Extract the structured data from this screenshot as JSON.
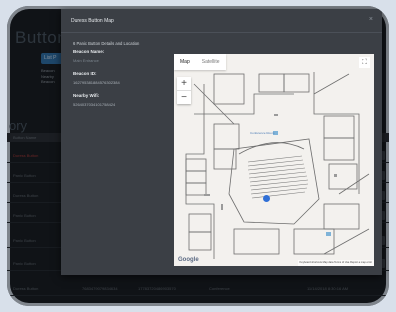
{
  "background": {
    "title": "Button D",
    "button_label": "List P",
    "info_lines": [
      "Beacon",
      "Nearby",
      "Beacon"
    ],
    "section_title": "ory",
    "table_header": "Button Name",
    "rows": [
      {
        "name": "Duress Button",
        "status": "red"
      },
      {
        "name": "Panic Button",
        "status": "normal"
      },
      {
        "name": "Duress Button",
        "status": "normal"
      },
      {
        "name": "Panic Button",
        "status": "normal"
      },
      {
        "name": "Panic Button",
        "status": "normal"
      },
      {
        "name": "Panic Button",
        "status": "normal"
      }
    ],
    "last_row": {
      "name": "Duress Button",
      "beacon": "7683479079834634",
      "mac": "17783720486903570",
      "location": "Conference",
      "date": "11/14/2018 8:30:16 AM"
    }
  },
  "modal": {
    "title": "Duress Button Map",
    "subtitle": "6 Panic Button Details and Location",
    "beacon_name_label": "Beacon Name:",
    "beacon_name_value": "Main Entrance",
    "beacon_id_label": "Beacon ID:",
    "beacon_id_value": "162795381884576302384",
    "nearby_wifi_label": "Nearby Wifi:",
    "nearby_wifi_value": "5264037034101758424",
    "close_glyph": "×"
  },
  "map": {
    "tab_map": "Map",
    "tab_satellite": "Satellite",
    "zoom_in": "+",
    "zoom_out": "−",
    "fullscreen_glyph": "⛶",
    "google_label": "Google",
    "attribution": "Keyboard shortcuts   Map data   Terms of Use   Report a map error",
    "room_label": "Conference Room",
    "pin_color": "#2f6fd6"
  }
}
